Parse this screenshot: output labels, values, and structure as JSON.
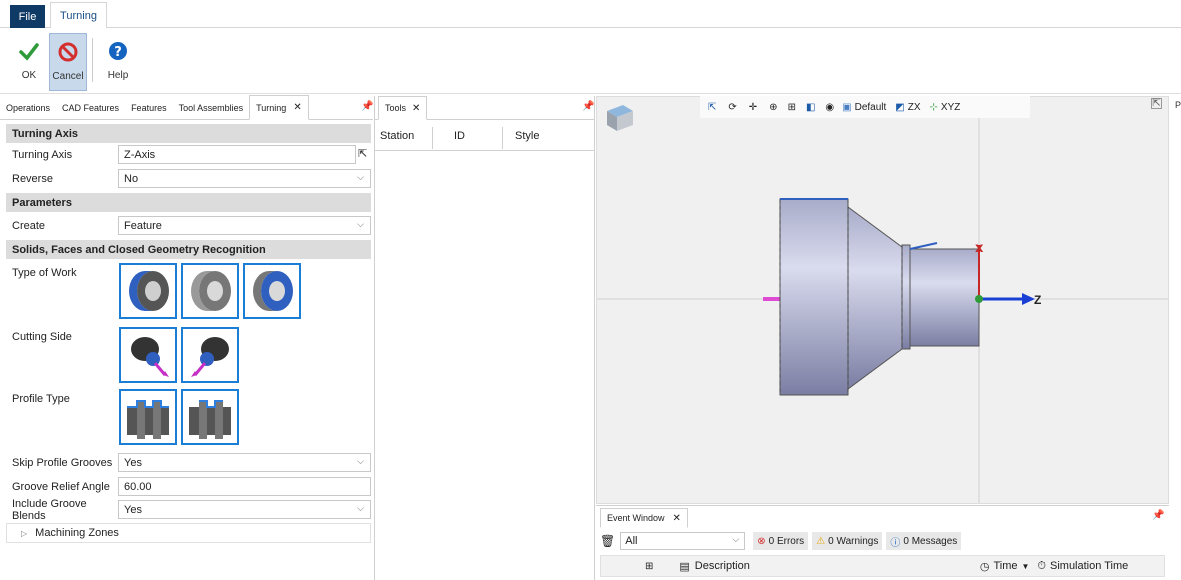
{
  "menu": {
    "file": "File",
    "turning": "Turning"
  },
  "ribbon": {
    "ok": "OK",
    "cancel": "Cancel",
    "help": "Help"
  },
  "left_tabs": [
    "Operations",
    "CAD Features",
    "Features",
    "Tool Assemblies",
    "Turning"
  ],
  "turning_axis": {
    "section": "Turning Axis",
    "axis_label": "Turning Axis",
    "axis_value": "Z-Axis",
    "reverse_label": "Reverse",
    "reverse_value": "No"
  },
  "parameters": {
    "section": "Parameters",
    "create_label": "Create",
    "create_value": "Feature"
  },
  "recognition": {
    "section": "Solids, Faces and Closed Geometry Recognition",
    "type_of_work": "Type of Work",
    "cutting_side": "Cutting Side",
    "profile_type": "Profile Type",
    "skip_label": "Skip Profile Grooves",
    "skip_value": "Yes",
    "relief_label": "Groove Relief Angle",
    "relief_value": "60.00",
    "blends_label": "Include Groove Blends",
    "blends_value": "Yes",
    "machining_zones": "Machining Zones"
  },
  "tools": {
    "tab": "Tools",
    "columns": [
      "Station",
      "ID",
      "Style"
    ]
  },
  "viewport": {
    "default": "Default",
    "zx": "ZX",
    "xyz": "XYZ",
    "axis_z": "Z",
    "side_letter": "P"
  },
  "event": {
    "tab": "Event Window",
    "filter": "All",
    "errors": "0 Errors",
    "warnings": "0 Warnings",
    "messages": "0 Messages",
    "description": "Description",
    "time": "Time",
    "sim_time": "Simulation Time"
  },
  "colors": {
    "accent": "#1a7fd4",
    "file_tab": "#0f3a66",
    "part_blue": "#2f5fbf"
  }
}
